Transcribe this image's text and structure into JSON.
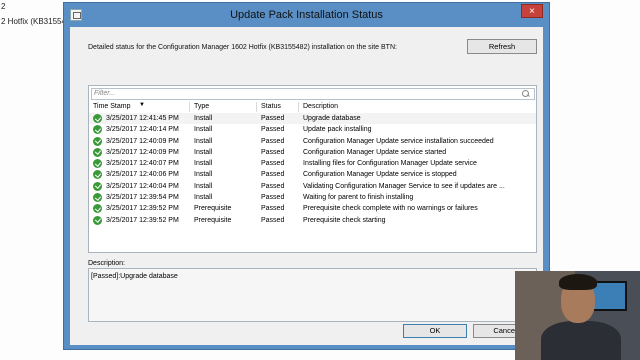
{
  "background": {
    "line1": "2",
    "line2": "2 Hotfix (KB31554"
  },
  "dialog": {
    "title": "Update Pack Installation Status",
    "close_label": "×",
    "detail_text": "Detailed status for the Configuration Manager 1602 Hotfix (KB3155482) installation on the site BTN:",
    "refresh_label": "Refresh",
    "filter_placeholder": "Filter...",
    "columns": {
      "timestamp": "Time Stamp",
      "type": "Type",
      "status": "Status",
      "description": "Description"
    },
    "rows": [
      {
        "timestamp": "3/25/2017 12:41:45 PM",
        "type": "Install",
        "status": "Passed",
        "description": "Upgrade database"
      },
      {
        "timestamp": "3/25/2017 12:40:14 PM",
        "type": "Install",
        "status": "Passed",
        "description": "Update pack installing"
      },
      {
        "timestamp": "3/25/2017 12:40:09 PM",
        "type": "Install",
        "status": "Passed",
        "description": "Configuration Manager Update service installation succeeded"
      },
      {
        "timestamp": "3/25/2017 12:40:09 PM",
        "type": "Install",
        "status": "Passed",
        "description": "Configuration Manager Update service started"
      },
      {
        "timestamp": "3/25/2017 12:40:07 PM",
        "type": "Install",
        "status": "Passed",
        "description": "Installing files for Configuration Manager Update service"
      },
      {
        "timestamp": "3/25/2017 12:40:06 PM",
        "type": "Install",
        "status": "Passed",
        "description": "Configuration Manager Update service is stopped"
      },
      {
        "timestamp": "3/25/2017 12:40:04 PM",
        "type": "Install",
        "status": "Passed",
        "description": "Validating Configuration Manager Service to see if updates are ..."
      },
      {
        "timestamp": "3/25/2017 12:39:54 PM",
        "type": "Install",
        "status": "Passed",
        "description": "Waiting for parent to finish installing"
      },
      {
        "timestamp": "3/25/2017 12:39:52 PM",
        "type": "Prerequisite",
        "status": "Passed",
        "description": "Prerequisite check complete with no warnings or failures"
      },
      {
        "timestamp": "3/25/2017 12:39:52 PM",
        "type": "Prerequisite",
        "status": "Passed",
        "description": "Prerequisite check starting"
      }
    ],
    "description_label": "Description:",
    "description_value": "[Passed]:Upgrade database",
    "ok_label": "OK",
    "cancel_label": "Cancel"
  },
  "colors": {
    "title_bar": "#5a8fc5",
    "close_button": "#c7423a",
    "status_ok": "#3a9a3a"
  },
  "icons": {
    "window": "window-icon",
    "status": "check-circle-icon",
    "filter": "search-icon"
  }
}
